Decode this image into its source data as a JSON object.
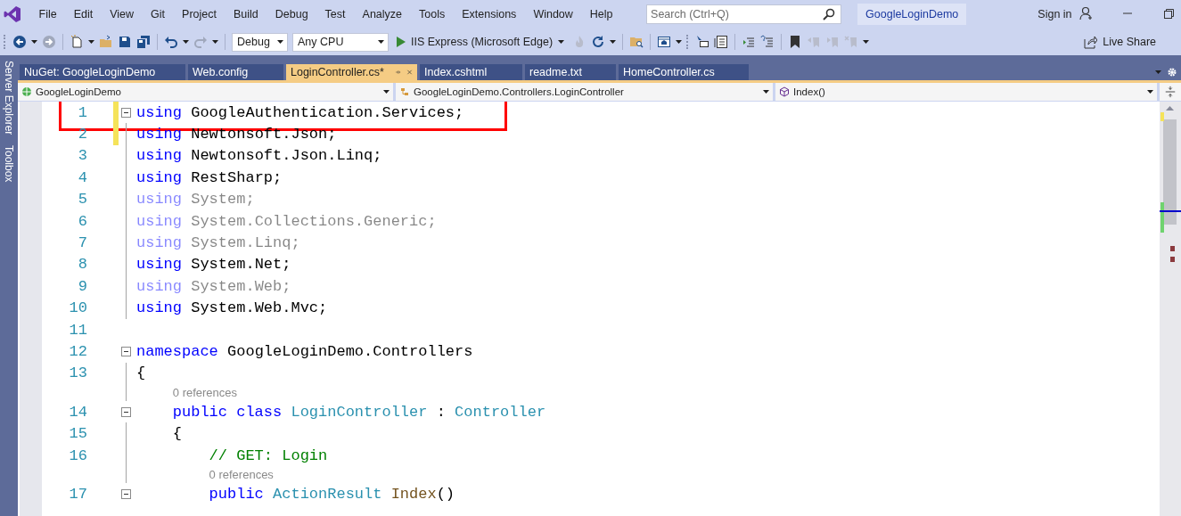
{
  "menu": [
    "File",
    "Edit",
    "View",
    "Git",
    "Project",
    "Build",
    "Debug",
    "Test",
    "Analyze",
    "Tools",
    "Extensions",
    "Window",
    "Help"
  ],
  "search": {
    "placeholder": "Search (Ctrl+Q)"
  },
  "solution_name": "GoogleLoginDemo",
  "sign_in": "Sign in",
  "toolbar": {
    "configuration": "Debug",
    "platform": "Any CPU",
    "run_target": "IIS Express (Microsoft Edge)",
    "live_share": "Live Share"
  },
  "side_tabs": [
    "Server Explorer",
    "Toolbox"
  ],
  "tabs": [
    {
      "label": "NuGet: GoogleLoginDemo",
      "selected": false
    },
    {
      "label": "Web.config",
      "selected": false
    },
    {
      "label": "LoginController.cs*",
      "selected": true
    },
    {
      "label": "Index.cshtml",
      "selected": false
    },
    {
      "label": "readme.txt",
      "selected": false
    },
    {
      "label": "HomeController.cs",
      "selected": false
    }
  ],
  "navigation": {
    "project": "GoogleLoginDemo",
    "type": "GoogleLoginDemo.Controllers.LoginController",
    "member": "Index()"
  },
  "lines": [
    {
      "number": "1",
      "fold": true,
      "modified": true,
      "faded": false,
      "highlighted": true,
      "tokens": [
        {
          "kind": "keyword",
          "text": "using"
        },
        {
          "kind": "plain",
          "text": " GoogleAuthentication.Services;"
        }
      ]
    },
    {
      "number": "2",
      "fold": false,
      "modified": true,
      "faded": false,
      "highlighted": false,
      "tokens": [
        {
          "kind": "keyword",
          "text": "using"
        },
        {
          "kind": "plain",
          "text": " Newtonsoft.Json;"
        }
      ]
    },
    {
      "number": "3",
      "fold": false,
      "modified": false,
      "faded": false,
      "highlighted": false,
      "tokens": [
        {
          "kind": "keyword",
          "text": "using"
        },
        {
          "kind": "plain",
          "text": " Newtonsoft.Json.Linq;"
        }
      ]
    },
    {
      "number": "4",
      "fold": false,
      "modified": false,
      "faded": false,
      "highlighted": false,
      "tokens": [
        {
          "kind": "keyword",
          "text": "using"
        },
        {
          "kind": "plain",
          "text": " RestSharp;"
        }
      ]
    },
    {
      "number": "5",
      "fold": false,
      "modified": false,
      "faded": true,
      "highlighted": false,
      "tokens": [
        {
          "kind": "keyword",
          "text": "using"
        },
        {
          "kind": "plain",
          "text": " System;"
        }
      ]
    },
    {
      "number": "6",
      "fold": false,
      "modified": false,
      "faded": true,
      "highlighted": false,
      "tokens": [
        {
          "kind": "keyword",
          "text": "using"
        },
        {
          "kind": "plain",
          "text": " System.Collections.Generic;"
        }
      ]
    },
    {
      "number": "7",
      "fold": false,
      "modified": false,
      "faded": true,
      "highlighted": false,
      "tokens": [
        {
          "kind": "keyword",
          "text": "using"
        },
        {
          "kind": "plain",
          "text": " System.Linq;"
        }
      ]
    },
    {
      "number": "8",
      "fold": false,
      "modified": false,
      "faded": false,
      "highlighted": false,
      "tokens": [
        {
          "kind": "keyword",
          "text": "using"
        },
        {
          "kind": "plain",
          "text": " System.Net;"
        }
      ]
    },
    {
      "number": "9",
      "fold": false,
      "modified": false,
      "faded": true,
      "highlighted": false,
      "tokens": [
        {
          "kind": "keyword",
          "text": "using"
        },
        {
          "kind": "plain",
          "text": " System.Web;"
        }
      ]
    },
    {
      "number": "10",
      "fold": false,
      "modified": false,
      "faded": false,
      "highlighted": false,
      "tokens": [
        {
          "kind": "keyword",
          "text": "using"
        },
        {
          "kind": "plain",
          "text": " System.Web.Mvc;"
        }
      ]
    },
    {
      "number": "11",
      "fold": false,
      "modified": false,
      "highlighted": false
    },
    {
      "number": "12",
      "fold": true,
      "modified": false,
      "faded": false,
      "highlighted": false,
      "tokens": [
        {
          "kind": "keyword",
          "text": "namespace"
        },
        {
          "kind": "plain",
          "text": " GoogleLoginDemo.Controllers"
        }
      ]
    },
    {
      "number": "13",
      "fold": false,
      "modified": false,
      "faded": false,
      "highlighted": false,
      "tokens": [
        {
          "kind": "plain",
          "text": "{"
        }
      ]
    },
    {
      "number": "14",
      "fold": true,
      "modified": false,
      "faded": false,
      "highlighted": false,
      "codelens": "0 references",
      "tokens": [
        {
          "kind": "keyword",
          "text": "    public class"
        },
        {
          "kind": "type",
          "text": " LoginController"
        },
        {
          "kind": "plain",
          "text": " : "
        },
        {
          "kind": "type",
          "text": "Controller"
        }
      ]
    },
    {
      "number": "15",
      "fold": false,
      "modified": false,
      "faded": false,
      "highlighted": false,
      "tokens": [
        {
          "kind": "plain",
          "text": "    {"
        }
      ]
    },
    {
      "number": "16",
      "fold": false,
      "modified": false,
      "faded": false,
      "highlighted": false,
      "tokens": [
        {
          "kind": "comment",
          "text": "        // GET: Login"
        }
      ]
    },
    {
      "number": "17",
      "fold": true,
      "modified": false,
      "faded": false,
      "highlighted": false,
      "codelens": "0 references",
      "tokens": [
        {
          "kind": "keyword",
          "text": "        public"
        },
        {
          "kind": "type",
          "text": " ActionResult"
        },
        {
          "kind": "method",
          "text": " Index"
        },
        {
          "kind": "plain",
          "text": "()"
        }
      ]
    }
  ]
}
